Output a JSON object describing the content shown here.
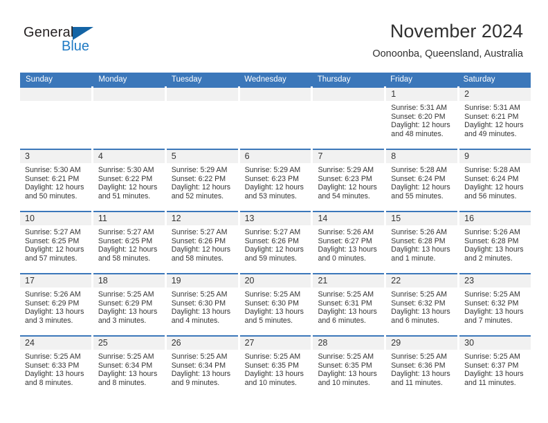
{
  "brand": {
    "name_part1": "General",
    "name_part2": "Blue",
    "logo_icon": "triangle-logo-icon",
    "accent_color": "#1464a5"
  },
  "header": {
    "title": "November 2024",
    "location": "Oonoonba, Queensland, Australia"
  },
  "calendar": {
    "header_color": "#3b77ba",
    "weekdays": [
      "Sunday",
      "Monday",
      "Tuesday",
      "Wednesday",
      "Thursday",
      "Friday",
      "Saturday"
    ],
    "weeks": [
      [
        {
          "day": "",
          "empty": true,
          "lines": []
        },
        {
          "day": "",
          "empty": true,
          "lines": []
        },
        {
          "day": "",
          "empty": true,
          "lines": []
        },
        {
          "day": "",
          "empty": true,
          "lines": []
        },
        {
          "day": "",
          "empty": true,
          "lines": []
        },
        {
          "day": "1",
          "empty": false,
          "lines": [
            "Sunrise: 5:31 AM",
            "Sunset: 6:20 PM",
            "Daylight: 12 hours",
            "and 48 minutes."
          ]
        },
        {
          "day": "2",
          "empty": false,
          "lines": [
            "Sunrise: 5:31 AM",
            "Sunset: 6:21 PM",
            "Daylight: 12 hours",
            "and 49 minutes."
          ]
        }
      ],
      [
        {
          "day": "3",
          "empty": false,
          "lines": [
            "Sunrise: 5:30 AM",
            "Sunset: 6:21 PM",
            "Daylight: 12 hours",
            "and 50 minutes."
          ]
        },
        {
          "day": "4",
          "empty": false,
          "lines": [
            "Sunrise: 5:30 AM",
            "Sunset: 6:22 PM",
            "Daylight: 12 hours",
            "and 51 minutes."
          ]
        },
        {
          "day": "5",
          "empty": false,
          "lines": [
            "Sunrise: 5:29 AM",
            "Sunset: 6:22 PM",
            "Daylight: 12 hours",
            "and 52 minutes."
          ]
        },
        {
          "day": "6",
          "empty": false,
          "lines": [
            "Sunrise: 5:29 AM",
            "Sunset: 6:23 PM",
            "Daylight: 12 hours",
            "and 53 minutes."
          ]
        },
        {
          "day": "7",
          "empty": false,
          "lines": [
            "Sunrise: 5:29 AM",
            "Sunset: 6:23 PM",
            "Daylight: 12 hours",
            "and 54 minutes."
          ]
        },
        {
          "day": "8",
          "empty": false,
          "lines": [
            "Sunrise: 5:28 AM",
            "Sunset: 6:24 PM",
            "Daylight: 12 hours",
            "and 55 minutes."
          ]
        },
        {
          "day": "9",
          "empty": false,
          "lines": [
            "Sunrise: 5:28 AM",
            "Sunset: 6:24 PM",
            "Daylight: 12 hours",
            "and 56 minutes."
          ]
        }
      ],
      [
        {
          "day": "10",
          "empty": false,
          "lines": [
            "Sunrise: 5:27 AM",
            "Sunset: 6:25 PM",
            "Daylight: 12 hours",
            "and 57 minutes."
          ]
        },
        {
          "day": "11",
          "empty": false,
          "lines": [
            "Sunrise: 5:27 AM",
            "Sunset: 6:25 PM",
            "Daylight: 12 hours",
            "and 58 minutes."
          ]
        },
        {
          "day": "12",
          "empty": false,
          "lines": [
            "Sunrise: 5:27 AM",
            "Sunset: 6:26 PM",
            "Daylight: 12 hours",
            "and 58 minutes."
          ]
        },
        {
          "day": "13",
          "empty": false,
          "lines": [
            "Sunrise: 5:27 AM",
            "Sunset: 6:26 PM",
            "Daylight: 12 hours",
            "and 59 minutes."
          ]
        },
        {
          "day": "14",
          "empty": false,
          "lines": [
            "Sunrise: 5:26 AM",
            "Sunset: 6:27 PM",
            "Daylight: 13 hours",
            "and 0 minutes."
          ]
        },
        {
          "day": "15",
          "empty": false,
          "lines": [
            "Sunrise: 5:26 AM",
            "Sunset: 6:28 PM",
            "Daylight: 13 hours",
            "and 1 minute."
          ]
        },
        {
          "day": "16",
          "empty": false,
          "lines": [
            "Sunrise: 5:26 AM",
            "Sunset: 6:28 PM",
            "Daylight: 13 hours",
            "and 2 minutes."
          ]
        }
      ],
      [
        {
          "day": "17",
          "empty": false,
          "lines": [
            "Sunrise: 5:26 AM",
            "Sunset: 6:29 PM",
            "Daylight: 13 hours",
            "and 3 minutes."
          ]
        },
        {
          "day": "18",
          "empty": false,
          "lines": [
            "Sunrise: 5:25 AM",
            "Sunset: 6:29 PM",
            "Daylight: 13 hours",
            "and 3 minutes."
          ]
        },
        {
          "day": "19",
          "empty": false,
          "lines": [
            "Sunrise: 5:25 AM",
            "Sunset: 6:30 PM",
            "Daylight: 13 hours",
            "and 4 minutes."
          ]
        },
        {
          "day": "20",
          "empty": false,
          "lines": [
            "Sunrise: 5:25 AM",
            "Sunset: 6:30 PM",
            "Daylight: 13 hours",
            "and 5 minutes."
          ]
        },
        {
          "day": "21",
          "empty": false,
          "lines": [
            "Sunrise: 5:25 AM",
            "Sunset: 6:31 PM",
            "Daylight: 13 hours",
            "and 6 minutes."
          ]
        },
        {
          "day": "22",
          "empty": false,
          "lines": [
            "Sunrise: 5:25 AM",
            "Sunset: 6:32 PM",
            "Daylight: 13 hours",
            "and 6 minutes."
          ]
        },
        {
          "day": "23",
          "empty": false,
          "lines": [
            "Sunrise: 5:25 AM",
            "Sunset: 6:32 PM",
            "Daylight: 13 hours",
            "and 7 minutes."
          ]
        }
      ],
      [
        {
          "day": "24",
          "empty": false,
          "lines": [
            "Sunrise: 5:25 AM",
            "Sunset: 6:33 PM",
            "Daylight: 13 hours",
            "and 8 minutes."
          ]
        },
        {
          "day": "25",
          "empty": false,
          "lines": [
            "Sunrise: 5:25 AM",
            "Sunset: 6:34 PM",
            "Daylight: 13 hours",
            "and 8 minutes."
          ]
        },
        {
          "day": "26",
          "empty": false,
          "lines": [
            "Sunrise: 5:25 AM",
            "Sunset: 6:34 PM",
            "Daylight: 13 hours",
            "and 9 minutes."
          ]
        },
        {
          "day": "27",
          "empty": false,
          "lines": [
            "Sunrise: 5:25 AM",
            "Sunset: 6:35 PM",
            "Daylight: 13 hours",
            "and 10 minutes."
          ]
        },
        {
          "day": "28",
          "empty": false,
          "lines": [
            "Sunrise: 5:25 AM",
            "Sunset: 6:35 PM",
            "Daylight: 13 hours",
            "and 10 minutes."
          ]
        },
        {
          "day": "29",
          "empty": false,
          "lines": [
            "Sunrise: 5:25 AM",
            "Sunset: 6:36 PM",
            "Daylight: 13 hours",
            "and 11 minutes."
          ]
        },
        {
          "day": "30",
          "empty": false,
          "lines": [
            "Sunrise: 5:25 AM",
            "Sunset: 6:37 PM",
            "Daylight: 13 hours",
            "and 11 minutes."
          ]
        }
      ]
    ]
  }
}
